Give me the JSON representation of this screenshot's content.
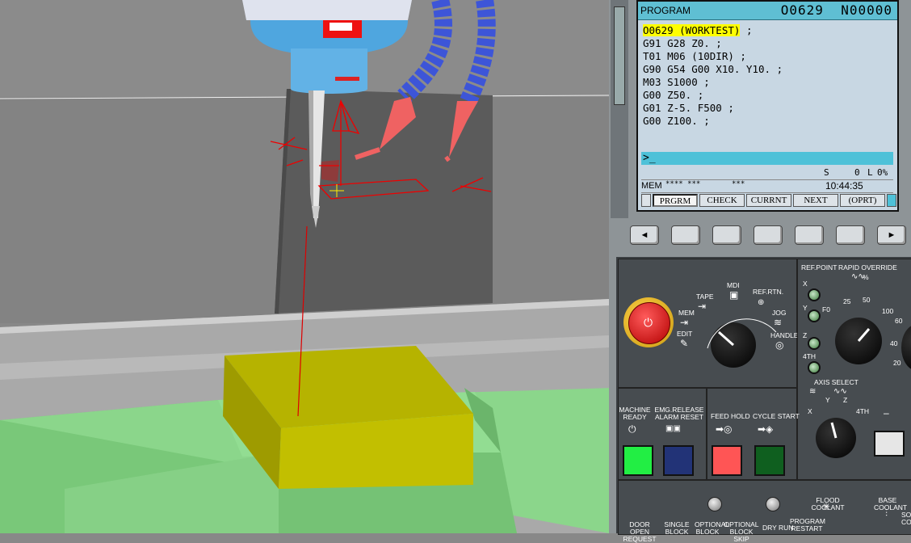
{
  "program_screen": {
    "title": "PROGRAM",
    "program_number": "O0629",
    "sequence_number": "N00000",
    "code_lines": [
      "O0629 (WORKTEST)",
      " ;",
      "G91 G28 Z0. ;",
      "T01 M06 (10DIR) ;",
      "G90 G54 G00 X10. Y10. ;",
      "M03 S1000 ;",
      "G00 Z50. ;",
      "G01 Z-5. F500 ;",
      "G00 Z100. ;"
    ],
    "command_prompt": ">_",
    "status_s_label": "S",
    "status_s_value": "0",
    "status_l_label": "L",
    "status_l_value": "0%",
    "mode": "MEM",
    "mode_stars": "**** ***",
    "mode_stars2": "***",
    "time": "10:44:35",
    "softkeys": [
      "PRGRM",
      "CHECK",
      "CURRNT",
      "NEXT",
      "(OPRT)"
    ],
    "colors": {
      "header": "#5fbfd3",
      "highlight": "#ffff00",
      "screen_bg": "#c8d7e3"
    }
  },
  "hw_keys": {
    "left_arrow": "◄",
    "right_arrow": "►"
  },
  "operator_panel": {
    "mode_labels": {
      "tape": "TAPE",
      "mdi": "MDI",
      "ref_rtn": "REF.RTN.",
      "mem": "MEM",
      "jog": "JOG",
      "edit": "EDIT",
      "handle": "HANDLE"
    },
    "ref_point": "REF.POINT",
    "rapid_override": "RAPID OVERRIDE",
    "rapid_override_unit": "%",
    "rapid_marks": [
      "F0",
      "25",
      "50",
      "100"
    ],
    "feed_marks": [
      "60",
      "40",
      "20"
    ],
    "axis_leds": [
      "X",
      "Y",
      "Z",
      "4TH"
    ],
    "axis_select": "AXIS SELECT",
    "axis_select_marks": [
      "X",
      "Y",
      "Z",
      "4TH"
    ],
    "axis_select_minus": "–",
    "machine_ready": "MACHINE READY",
    "emg_release": "EMG.RELEASE ALARM RESET",
    "feed_hold": "FEED HOLD",
    "cycle_start": "CYCLE START",
    "bottom_labels": [
      "DOOR OPEN REQUEST",
      "SINGLE BLOCK",
      "OPTIONAL BLOCK",
      "OPTIONAL BLOCK SKIP",
      "DRY RUN",
      "PROGRAM RESTART",
      "FLOOD COOLANT",
      "BASE COOLANT",
      "SO CO"
    ],
    "button_colors": {
      "machine_ready": "#22ee44",
      "emg_release": "#223377",
      "feed_hold": "#ff5555",
      "cycle_start": "#0f5f1f",
      "axis_plus": "#e6e6e6"
    }
  }
}
